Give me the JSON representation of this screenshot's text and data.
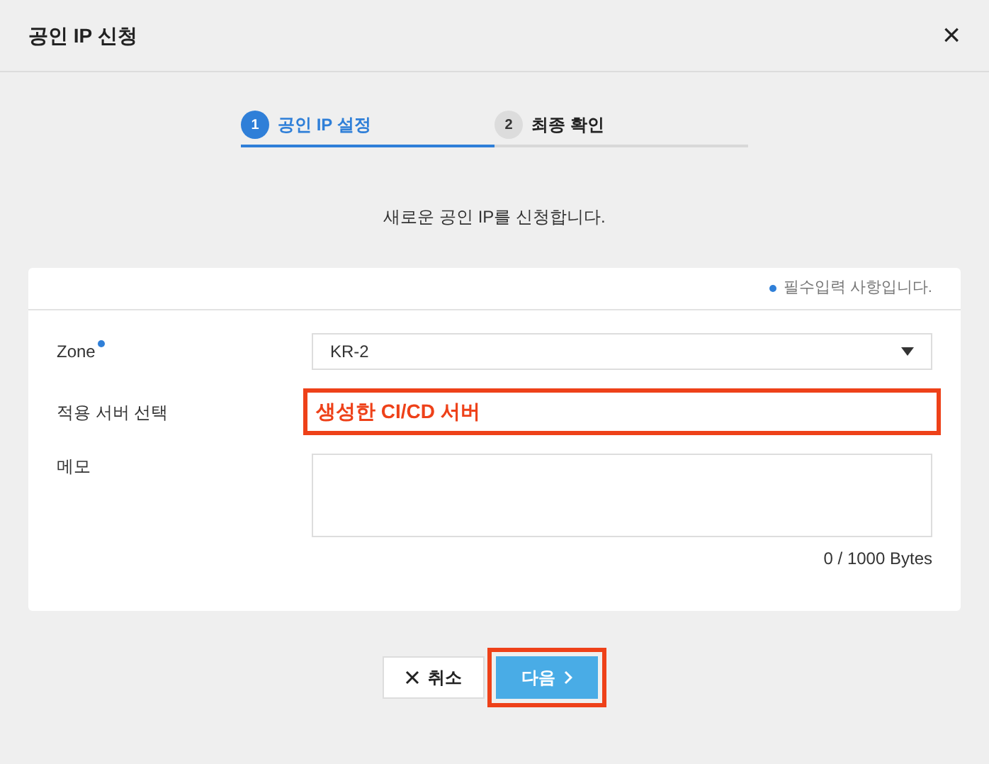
{
  "dialog": {
    "title": "공인 IP 신청",
    "close": "×"
  },
  "steps": [
    {
      "number": "1",
      "label": "공인 IP 설정",
      "selected": true
    },
    {
      "number": "2",
      "label": "최종 확인",
      "selected": false
    }
  ],
  "description": "새로운 공인 IP를 신청합니다.",
  "form": {
    "required_note": "필수입력 사항입니다.",
    "fields": [
      {
        "kind": "select",
        "label": "Zone",
        "required": true,
        "value": "KR-2"
      },
      {
        "kind": "text",
        "label": "적용 서버 선택",
        "value": "생성한 CI/CD 서버",
        "highlighted": true
      },
      {
        "kind": "textarea",
        "label": "메모",
        "counter": "0 / 1000 Bytes"
      }
    ]
  },
  "buttons": [
    {
      "kind": "cancel",
      "label": "취소",
      "highlighted": false
    },
    {
      "kind": "next",
      "label": "다음",
      "highlighted": true
    }
  ]
}
